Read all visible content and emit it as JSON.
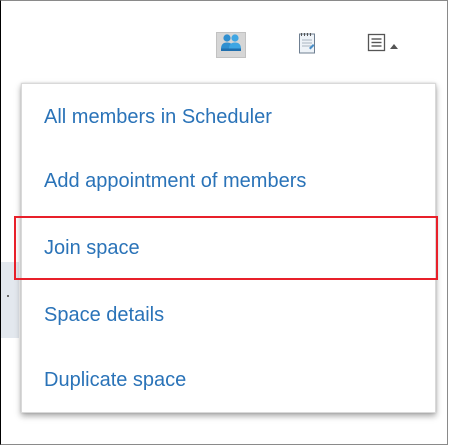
{
  "toolbar": {
    "members_icon": "people-icon",
    "notes_icon": "notepad-icon",
    "menu_icon": "list-menu-icon",
    "menu_caret_icon": "caret-up-icon",
    "members_active": true
  },
  "menu": {
    "items": [
      {
        "label": "All members in Scheduler"
      },
      {
        "label": "Add appointment of members"
      },
      {
        "label": "Join space"
      },
      {
        "label": "Space details"
      },
      {
        "label": "Duplicate space"
      }
    ],
    "highlighted_item": "Join space"
  },
  "colors": {
    "link": "#2a73b8",
    "highlight_border": "#e8202a",
    "active_button_bg": "#d6d6d6",
    "members_icon": "#3d9bd6"
  }
}
